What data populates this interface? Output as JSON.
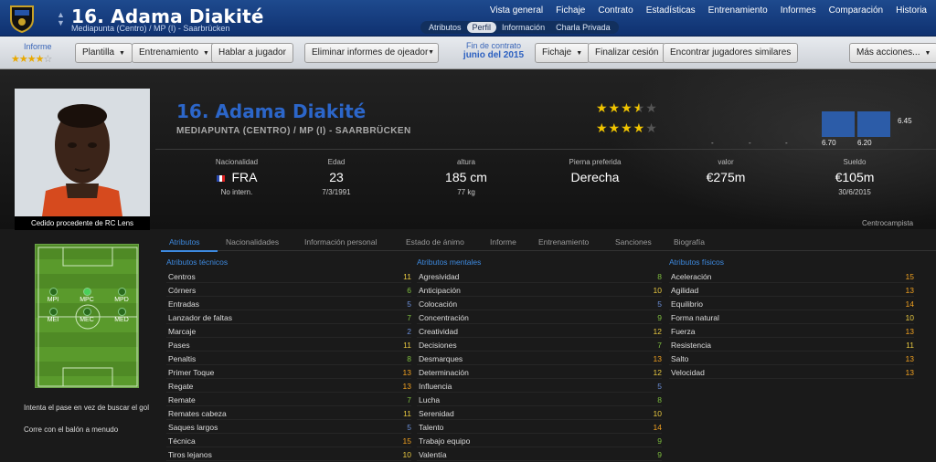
{
  "header": {
    "title": "16. Adama Diakité",
    "subtitle": "Mediapunta (Centro) / MP (I) - Saarbrücken",
    "nav": [
      "Vista general",
      "Fichaje",
      "Contrato",
      "Estadísticas",
      "Entrenamiento",
      "Informes",
      "Comparación",
      "Historia"
    ],
    "subtabs": [
      "Atributos",
      "Perfil",
      "Información",
      "Charla Privada"
    ],
    "active_subtab": "Perfil"
  },
  "toolbar": {
    "informe_label": "Informe",
    "informe_stars": 4,
    "buttons": [
      "Plantilla",
      "Entrenamiento",
      "Hablar a jugador",
      "Eliminar informes de ojeador",
      "Fichaje",
      "Finalizar cesión",
      "Encontrar jugadores similares",
      "Más acciones..."
    ],
    "contract_label": "Fin de contrato",
    "contract_value": "junio del 2015"
  },
  "player": {
    "name": "16. Adama Diakité",
    "position": "MEDIAPUNTA (CENTRO) / MP (I) - SAARBRÜCKEN",
    "loan_caption": "Cedido procedente de RC Lens",
    "current_ability_stars": 3.5,
    "potential_ability_stars": 4,
    "ratings": [
      "6.45",
      "6.70",
      "6.20"
    ],
    "ratings_dashes": "-"
  },
  "stats": {
    "nacionalidad": {
      "label": "Nacionalidad",
      "value": "FRA",
      "sub": "No intern."
    },
    "edad": {
      "label": "Edad",
      "value": "23",
      "sub": "7/3/1991"
    },
    "altura": {
      "label": "altura",
      "value": "185 cm",
      "sub": "77 kg"
    },
    "pierna": {
      "label": "Pierna preferida",
      "value": "Derecha"
    },
    "valor": {
      "label": "valor",
      "value": "€275m"
    },
    "sueldo": {
      "label": "Sueldo",
      "value": "€105m",
      "sub": "30/6/2015"
    }
  },
  "role": "Centrocampista",
  "tabs": [
    "Atributos",
    "Nacionalidades",
    "Información personal",
    "Estado de ánimo",
    "Informe",
    "Entrenamiento",
    "Sanciones",
    "Biografía"
  ],
  "pitch": {
    "positions": [
      "MPI",
      "MPC",
      "MPD",
      "MEI",
      "MEC",
      "MED"
    ],
    "traits": [
      "Intenta el pase en vez de buscar el gol",
      "Corre con el balón a menudo"
    ]
  },
  "colors": {
    "high": "#f0a020",
    "mid": "#e8c840",
    "low": "#7fbf3f",
    "poor": "#6a8ed8"
  },
  "attributes": {
    "tecnicos": {
      "title": "Atributos técnicos",
      "items": [
        {
          "name": "Centros",
          "value": 11
        },
        {
          "name": "Córners",
          "value": 6
        },
        {
          "name": "Entradas",
          "value": 5
        },
        {
          "name": "Lanzador de faltas",
          "value": 7
        },
        {
          "name": "Marcaje",
          "value": 2
        },
        {
          "name": "Pases",
          "value": 11
        },
        {
          "name": "Penaltis",
          "value": 8
        },
        {
          "name": "Primer Toque",
          "value": 13
        },
        {
          "name": "Regate",
          "value": 13
        },
        {
          "name": "Remate",
          "value": 7
        },
        {
          "name": "Remates cabeza",
          "value": 11
        },
        {
          "name": "Saques largos",
          "value": 5
        },
        {
          "name": "Técnica",
          "value": 15
        },
        {
          "name": "Tiros lejanos",
          "value": 10
        }
      ]
    },
    "mentales": {
      "title": "Atributos mentales",
      "items": [
        {
          "name": "Agresividad",
          "value": 8
        },
        {
          "name": "Anticipación",
          "value": 10
        },
        {
          "name": "Colocación",
          "value": 5
        },
        {
          "name": "Concentración",
          "value": 9
        },
        {
          "name": "Creatividad",
          "value": 12
        },
        {
          "name": "Decisiones",
          "value": 7
        },
        {
          "name": "Desmarques",
          "value": 13
        },
        {
          "name": "Determinación",
          "value": 12
        },
        {
          "name": "Influencia",
          "value": 5
        },
        {
          "name": "Lucha",
          "value": 8
        },
        {
          "name": "Serenidad",
          "value": 10
        },
        {
          "name": "Talento",
          "value": 14
        },
        {
          "name": "Trabajo equipo",
          "value": 9
        },
        {
          "name": "Valentía",
          "value": 9
        }
      ]
    },
    "fisicos": {
      "title": "Atributos físicos",
      "items": [
        {
          "name": "Aceleración",
          "value": 15
        },
        {
          "name": "Agilidad",
          "value": 13
        },
        {
          "name": "Equilibrio",
          "value": 14
        },
        {
          "name": "Forma natural",
          "value": 10
        },
        {
          "name": "Fuerza",
          "value": 13
        },
        {
          "name": "Resistencia",
          "value": 11
        },
        {
          "name": "Salto",
          "value": 13
        },
        {
          "name": "Velocidad",
          "value": 13
        }
      ]
    }
  }
}
